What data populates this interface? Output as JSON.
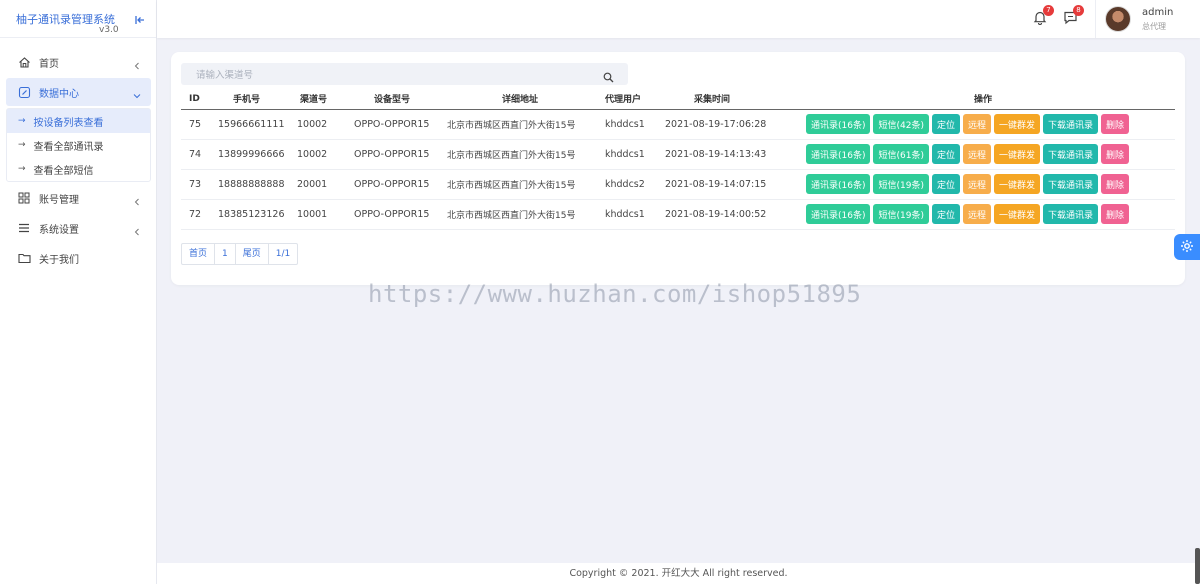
{
  "brand": {
    "title": "柚子通讯录管理系统",
    "version": "v3.0"
  },
  "sidebar": {
    "items": [
      {
        "label": "首页"
      },
      {
        "label": "数据中心"
      },
      {
        "label": "账号管理"
      },
      {
        "label": "系统设置"
      },
      {
        "label": "关于我们"
      }
    ],
    "sub_items": [
      {
        "label": "按设备列表查看"
      },
      {
        "label": "查看全部通讯录"
      },
      {
        "label": "查看全部短信"
      }
    ]
  },
  "header": {
    "notification_count": "7",
    "message_count": "8",
    "user_name": "admin",
    "user_role": "总代理"
  },
  "search": {
    "placeholder": "请输入渠道号"
  },
  "table": {
    "headers": [
      "ID",
      "手机号",
      "渠道号",
      "设备型号",
      "详细地址",
      "代理用户",
      "采集时间",
      "操作"
    ],
    "rows": [
      {
        "id": "75",
        "phone": "15966661111",
        "channel": "10002",
        "model": "OPPO-OPPOR15",
        "address": "北京市西城区西直门外大街15号",
        "agent": "khddcs1",
        "time": "2021-08-19-17:06:28",
        "contacts_btn": "通讯录(16条)",
        "sms_btn": "短信(42条)"
      },
      {
        "id": "74",
        "phone": "13899996666",
        "channel": "10002",
        "model": "OPPO-OPPOR15",
        "address": "北京市西城区西直门外大街15号",
        "agent": "khddcs1",
        "time": "2021-08-19-14:13:43",
        "contacts_btn": "通讯录(16条)",
        "sms_btn": "短信(61条)"
      },
      {
        "id": "73",
        "phone": "18888888888",
        "channel": "20001",
        "model": "OPPO-OPPOR15",
        "address": "北京市西城区西直门外大街15号",
        "agent": "khddcs2",
        "time": "2021-08-19-14:07:15",
        "contacts_btn": "通讯录(16条)",
        "sms_btn": "短信(19条)"
      },
      {
        "id": "72",
        "phone": "18385123126",
        "channel": "10001",
        "model": "OPPO-OPPOR15",
        "address": "北京市西城区西直门外大街15号",
        "agent": "khddcs1",
        "time": "2021-08-19-14:00:52",
        "contacts_btn": "通讯录(16条)",
        "sms_btn": "短信(19条)"
      }
    ],
    "actions": {
      "locate": "定位",
      "remote": "远程",
      "broadcast": "一键群发",
      "download": "下载通讯录",
      "delete": "删除"
    }
  },
  "pager": {
    "first": "首页",
    "page": "1",
    "last": "尾页",
    "info": "1/1"
  },
  "watermark": "https://www.huzhan.com/ishop51895",
  "footer": "Copyright © 2021. 开红大大 All right reserved.",
  "colors": {
    "accent": "#3a6fd8",
    "green": "#2fcc98",
    "teal": "#21b8ab",
    "orange": "#f7ad4b",
    "pink": "#f06292",
    "badge": "#e63b3b"
  }
}
